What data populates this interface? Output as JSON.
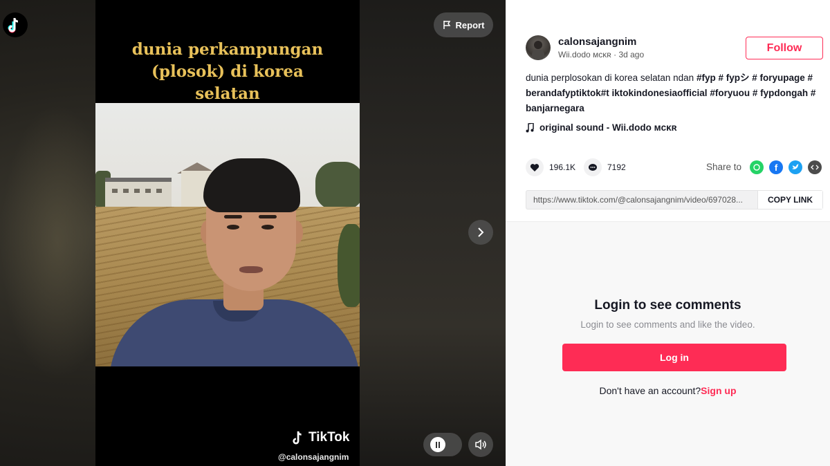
{
  "video": {
    "report_label": "Report",
    "caption_lines": [
      "dunia perkampungan",
      "(plosok) di korea",
      "selatan"
    ],
    "watermark_brand": "TikTok",
    "watermark_handle": "@calonsajangnim"
  },
  "author": {
    "username": "calonsajangnim",
    "nickname": "Wii.dodo ᴍᴄᴋʀ",
    "separator": " · ",
    "posted": "3d ago",
    "follow_label": "Follow"
  },
  "description": {
    "text": "dunia perplosokan di korea selatan ndan ",
    "tags": [
      "#fyp",
      "# fypシ",
      "# foryupage",
      "# berandafyptiktok#t iktokindonesiaofficial",
      "#foryuou",
      "# fypdongah",
      "# banjarnegara"
    ]
  },
  "music": {
    "label": "original sound - Wii.dodo ᴍᴄᴋʀ",
    "icon": "music-note-icon"
  },
  "stats": {
    "likes": "196.1K",
    "comments": "7192"
  },
  "share": {
    "label": "Share to",
    "targets": [
      "whatsapp",
      "facebook",
      "twitter",
      "embed"
    ],
    "colors": {
      "whatsapp": "#25d366",
      "facebook": "#1877f2",
      "twitter": "#1da1f2",
      "embed": "#4c4c4c"
    }
  },
  "link": {
    "url": "https://www.tiktok.com/@calonsajangnim/video/697028...",
    "copy_label": "COPY LINK"
  },
  "comments": {
    "title": "Login to see comments",
    "subtitle": "Login to see comments and like the video.",
    "login_label": "Log in",
    "signup_prompt": "Don't have an account?",
    "signup_label": "Sign up"
  },
  "colors": {
    "brand": "#fe2c55",
    "caption": "#e8c15a"
  }
}
